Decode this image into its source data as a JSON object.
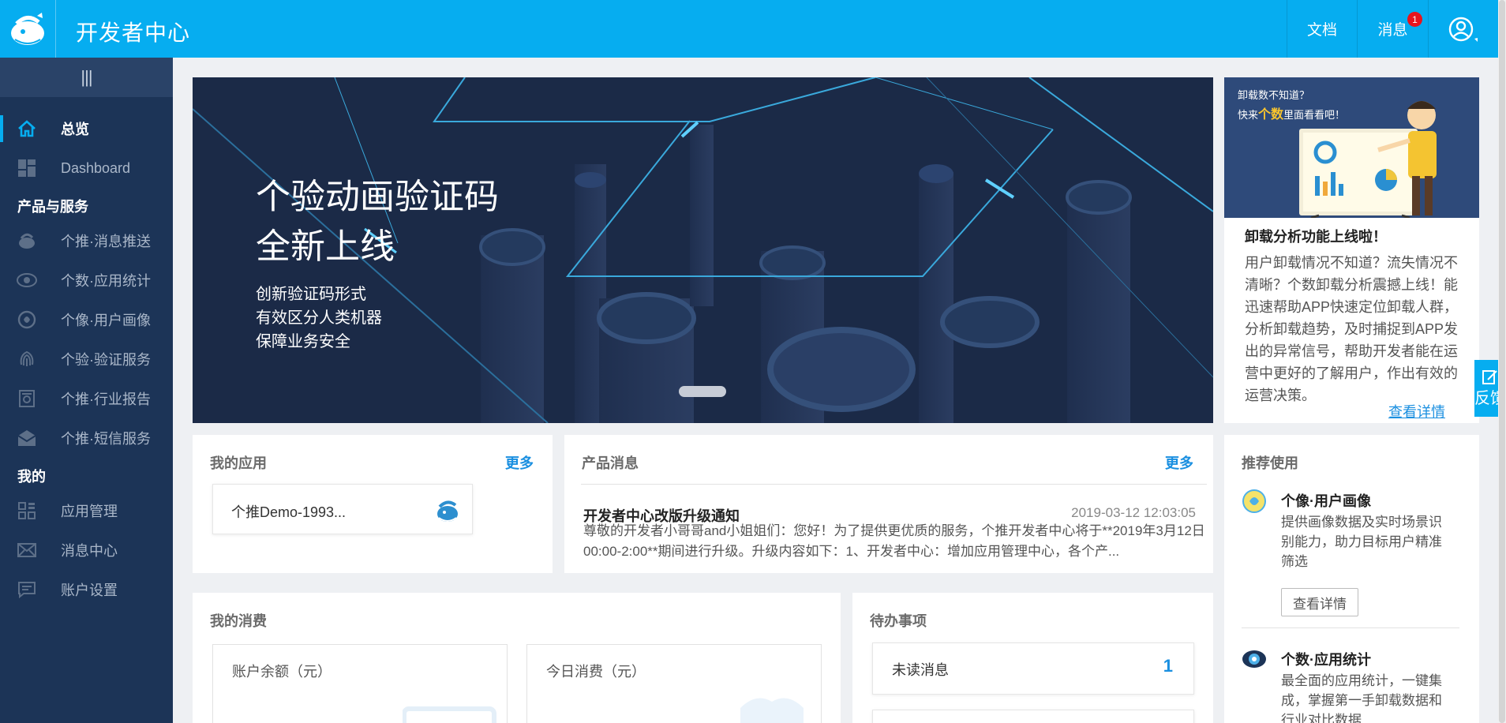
{
  "header": {
    "brand": "开发者中心",
    "docs_label": "文档",
    "messages_label": "消息",
    "messages_badge": "1"
  },
  "sidebar": {
    "items": [
      {
        "label": "总览",
        "icon": "home-icon"
      },
      {
        "label": "Dashboard",
        "icon": "dashboard-icon"
      },
      {
        "label": "个推·消息推送",
        "icon": "push-icon"
      },
      {
        "label": "个数·应用统计",
        "icon": "eye-icon"
      },
      {
        "label": "个像·用户画像",
        "icon": "portrait-icon"
      },
      {
        "label": "个验·验证服务",
        "icon": "fingerprint-icon"
      },
      {
        "label": "个推·行业报告",
        "icon": "report-icon"
      },
      {
        "label": "个推·短信服务",
        "icon": "sms-icon"
      },
      {
        "label": "应用管理",
        "icon": "app-grid-icon"
      },
      {
        "label": "消息中心",
        "icon": "mail-icon"
      },
      {
        "label": "账户设置",
        "icon": "settings-chat-icon"
      }
    ],
    "groups": [
      "产品与服务",
      "我的"
    ]
  },
  "banner": {
    "title_line1": "个验动画验证码",
    "title_line2": "全新上线",
    "sub1": "创新验证码形式",
    "sub2": "有效区分人类机器",
    "sub3": "保障业务安全"
  },
  "promo": {
    "img_q1": "卸载数不知道？",
    "img_q2_prefix": "快来",
    "img_q2_highlight": "个数",
    "img_q2_suffix": "里面看看吧！",
    "title": "卸载分析功能上线啦！",
    "text": "用户卸载情况不知道？流失情况不清晰？个数卸载分析震撼上线！能迅速帮助APP快速定位卸载人群，分析卸载趋势，及时捕捉到APP发出的异常信号，帮助开发者能在运营中更好的了解用户，作出有效的运营决策。",
    "link": "查看详情"
  },
  "feedback": {
    "label": "反馈"
  },
  "my_apps": {
    "title": "我的应用",
    "more": "更多",
    "app_name": "个推Demo-1993..."
  },
  "product_msg": {
    "title": "产品消息",
    "more": "更多",
    "item_title": "开发者中心改版升级通知",
    "item_date": "2019-03-12 12:03:05",
    "item_body": "尊敬的开发者小哥哥and小姐姐们：您好！为了提供更优质的服务，个推开发者中心将于**2019年3月12日00:00-2:00**期间进行升级。升级内容如下：1、开发者中心：增加应用管理中心，各个产..."
  },
  "recommend": {
    "title": "推荐使用",
    "items": [
      {
        "title": "个像·用户画像",
        "desc": "提供画像数据及实时场景识别能力，助力目标用户精准筛选",
        "button": "查看详情"
      },
      {
        "title": "个数·应用统计",
        "desc": "最全面的应用统计，一键集成，掌握第一手卸载数据和行业对比数据"
      }
    ]
  },
  "consumption": {
    "title": "我的消费",
    "balance_label": "账户余额（元）",
    "today_label": "今日消费（元）"
  },
  "todo": {
    "title": "待办事项",
    "unread_label": "未读消息",
    "unread_count": "1"
  },
  "colors": {
    "header": "#06adf0",
    "sidebar": "#1c3457",
    "accent": "#1a8fe0",
    "badge": "#e8141d"
  }
}
